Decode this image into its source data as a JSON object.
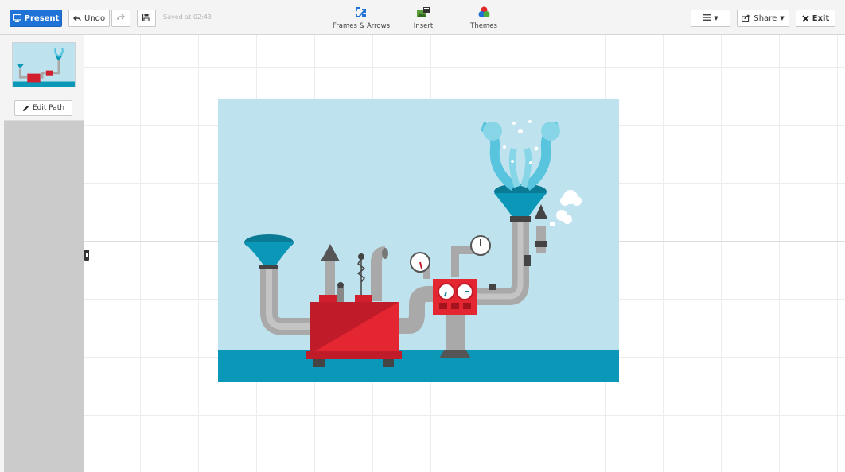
{
  "toolbar": {
    "present_label": "Present",
    "undo_label": "Undo",
    "saved_text": "Saved at 02:43",
    "frames_label": "Frames & Arrows",
    "insert_label": "Insert",
    "themes_label": "Themes",
    "share_label": "Share",
    "exit_label": "Exit"
  },
  "sidebar": {
    "edit_path_label": "Edit Path"
  },
  "colors": {
    "accent": "#1f72d6",
    "slide_bg": "#bfe3ee",
    "water": "#0a97b8",
    "machine_red": "#d11f2d",
    "pipe_gray": "#a9a9a9"
  },
  "icons": [
    "present-icon",
    "undo-icon",
    "redo-icon",
    "save-icon",
    "frames-arrows-icon",
    "insert-icon",
    "themes-icon",
    "menu-icon",
    "share-icon",
    "close-icon",
    "pencil-icon"
  ]
}
